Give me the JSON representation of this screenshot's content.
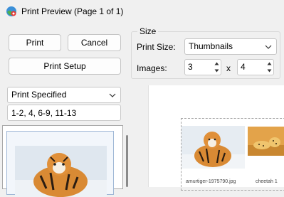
{
  "window": {
    "title": "Print Preview (Page 1 of 1)"
  },
  "buttons": {
    "print": "Print",
    "cancel": "Cancel",
    "print_setup": "Print Setup"
  },
  "size_group": {
    "label": "Size",
    "print_size_label": "Print Size:",
    "print_size_value": "Thumbnails",
    "images_label": "Images:",
    "images_cols": "3",
    "images_x": "x",
    "images_rows": "4"
  },
  "print_range": {
    "mode": "Print Specified",
    "pages": "1-2, 4, 6-9, 11-13"
  },
  "preview": {
    "captions": [
      "amurtiger-1975790.jpg",
      "cheetah 1"
    ]
  },
  "colors": {
    "accent": "#0067c0",
    "background": "#f0f0f0"
  }
}
